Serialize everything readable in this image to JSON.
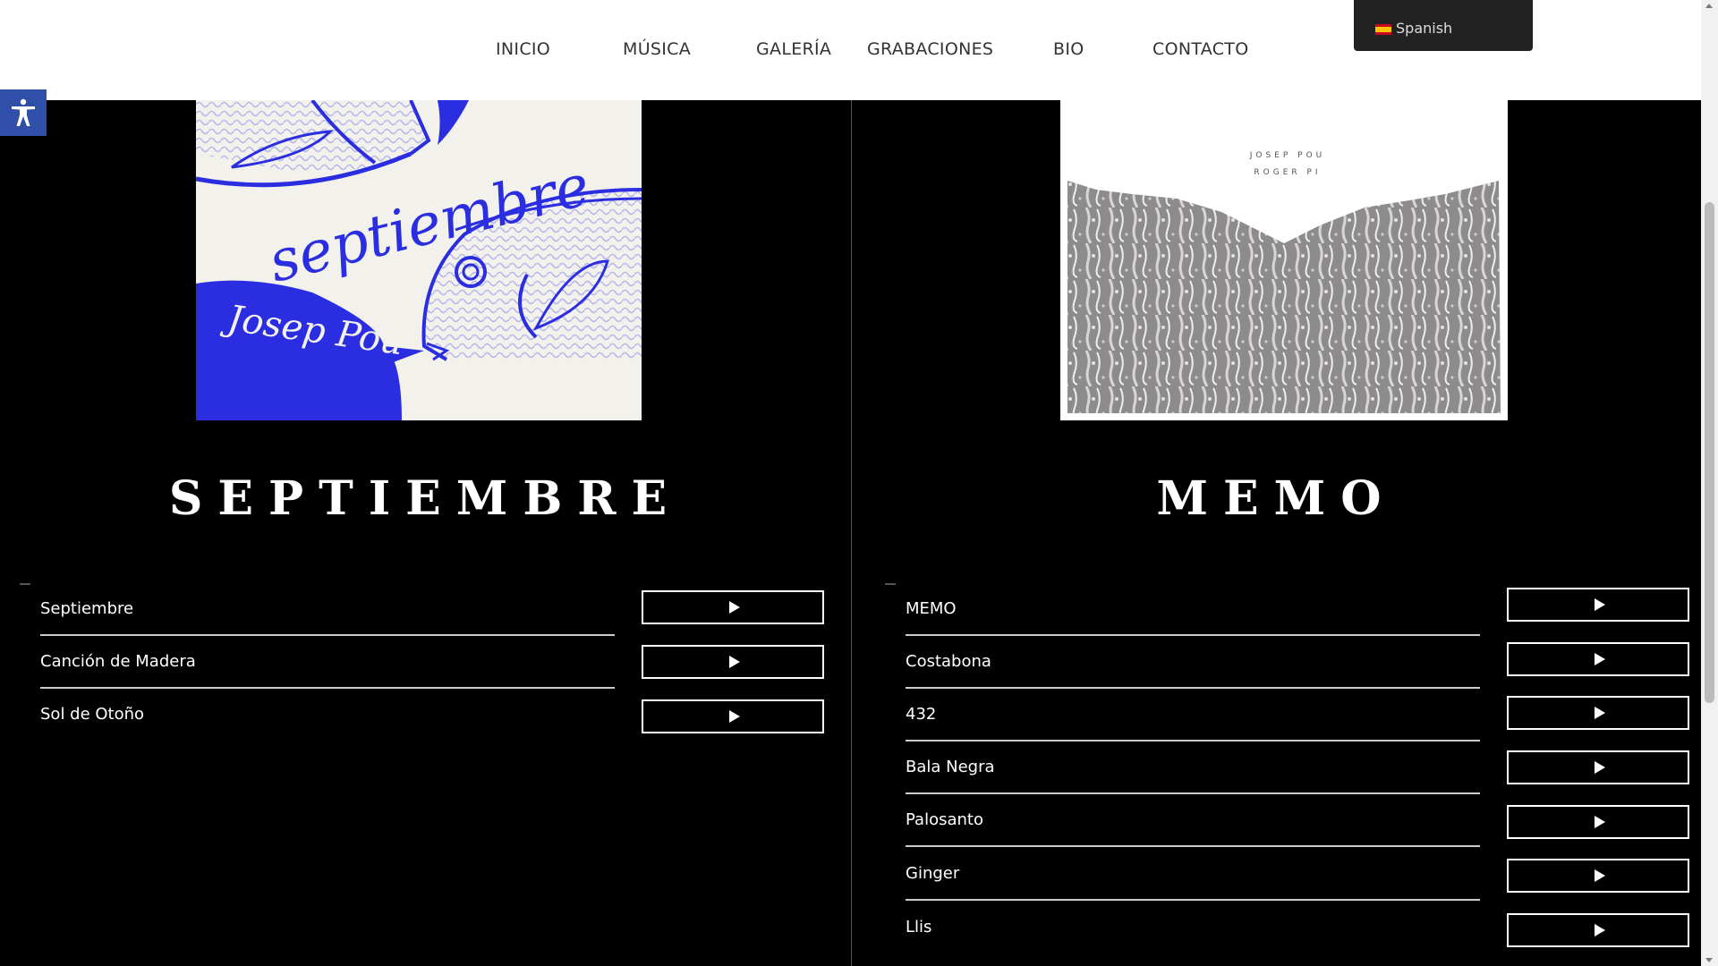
{
  "nav": {
    "items": [
      "INICIO",
      "MÚSICA",
      "GALERÍA",
      "GRABACIONES",
      "BIO",
      "CONTACTO"
    ],
    "language": "Spanish"
  },
  "albums": [
    {
      "title": "SEPTIEMBRE",
      "cover_text": "septiembre",
      "cover_artist": "Josep Pou",
      "tracks": [
        "Septiembre",
        "Canción de Madera",
        "Sol de Otoño"
      ]
    },
    {
      "title": "MEMO",
      "cover_artists": [
        "JOSEP POU",
        "ROGER PI"
      ],
      "tracks": [
        "MEMO",
        "Costabona",
        "432",
        "Bala Negra",
        "Palosanto",
        "Ginger",
        "Llis"
      ]
    }
  ],
  "colors": {
    "header_bg": "#ffffff",
    "page_bg": "#000000",
    "accent_blue": "#2b2ee0",
    "accessibility_blue": "#2f4fa8"
  }
}
